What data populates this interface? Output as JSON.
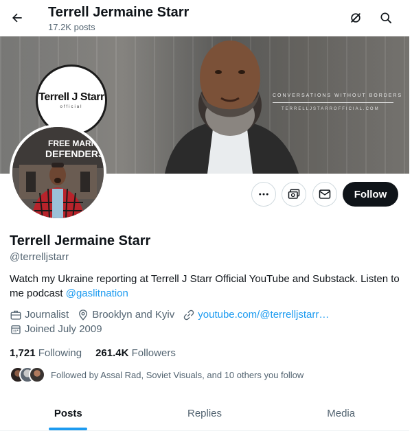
{
  "header": {
    "title": "Terrell Jermaine Starr",
    "post_count": "17.2K posts"
  },
  "banner": {
    "logo_text": "Terrell J Starr",
    "logo_sub": "official",
    "tagline": "CONVERSATIONS WITHOUT BORDERS",
    "url": "TERRELLJSTARROFFICIAL.COM"
  },
  "avatar": {
    "sign_line1": "FREE MARIUP",
    "sign_line2": "DEFENDERS"
  },
  "actions": {
    "follow_label": "Follow"
  },
  "profile": {
    "name": "Terrell Jermaine Starr",
    "handle": "@terrelljstarr",
    "bio_text": "Watch my Ukraine reporting at Terrell J Starr Official YouTube and Substack. Listen to me podcast ",
    "bio_mention": "@gaslitnation",
    "profession": "Journalist",
    "location": "Brooklyn and Kyiv",
    "website": "youtube.com/@terrelljstarr…",
    "joined": "Joined July 2009"
  },
  "stats": {
    "following_count": "1,721",
    "following_label": "Following",
    "followers_count": "261.4K",
    "followers_label": "Followers"
  },
  "followed_by": {
    "text": "Followed by Assal Rad, Soviet Visuals, and 10 others you follow"
  },
  "tabs": [
    {
      "label": "Posts"
    },
    {
      "label": "Replies"
    },
    {
      "label": "Media"
    }
  ],
  "colors": {
    "accent": "#1d9bf0",
    "text_primary": "#0f1419",
    "text_secondary": "#536471",
    "follow_button": "#0f1419"
  }
}
